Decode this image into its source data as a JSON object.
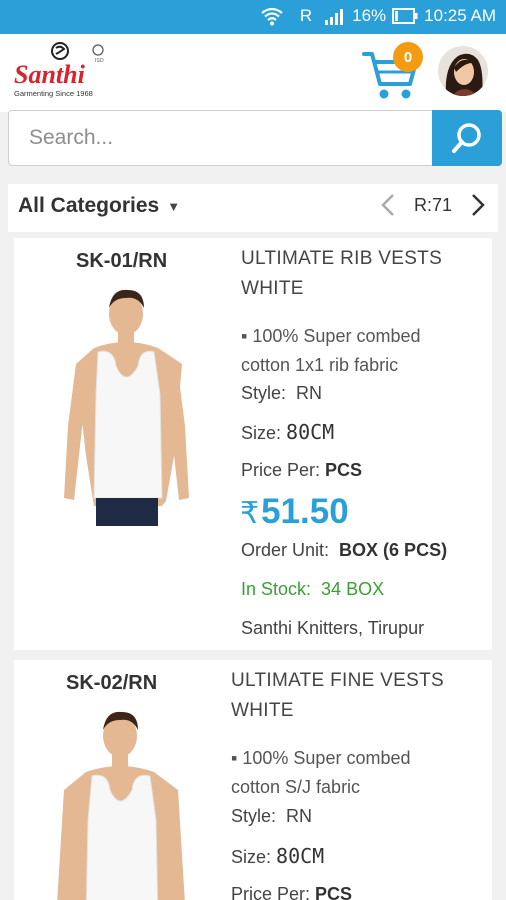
{
  "status_bar": {
    "network": "R",
    "battery": "16%",
    "time": "10:25 AM"
  },
  "header": {
    "brand": "Santhi",
    "tagline": "Garmenting Since 1968",
    "cart_count": "0"
  },
  "search": {
    "placeholder": "Search..."
  },
  "category_bar": {
    "selected": "All Categories",
    "record_label": "R:71"
  },
  "products": [
    {
      "code": "SK-01/RN",
      "title_line1": "ULTIMATE RIB VESTS",
      "title_line2": "WHITE",
      "feature_line1": "▪ 100% Super combed",
      "feature_line2": "cotton 1x1 rib fabric",
      "style_label": "Style:",
      "style_value": "RN",
      "size_label": "Size:",
      "size_value": "80CM",
      "price_per_label": "Price Per:",
      "price_per_value": "PCS",
      "currency": "₹",
      "price": "51.50",
      "order_unit_label": "Order Unit:",
      "order_unit_value": "BOX (6 PCS)",
      "stock_label": "In Stock:",
      "stock_value": "34 BOX",
      "seller": "Santhi Knitters, Tirupur"
    },
    {
      "code": "SK-02/RN",
      "title_line1": "ULTIMATE FINE VESTS",
      "title_line2": "WHITE",
      "feature_line1": "▪ 100% Super combed",
      "feature_line2": "cotton S/J fabric",
      "style_label": "Style:",
      "style_value": "RN",
      "size_label": "Size:",
      "size_value": "80CM",
      "price_per_label": "Price Per:",
      "price_per_value": "PCS"
    }
  ],
  "colors": {
    "accent": "#2a9fd8",
    "badge": "#f39c12",
    "stock": "#3aa035",
    "brand_red": "#d9232d"
  }
}
